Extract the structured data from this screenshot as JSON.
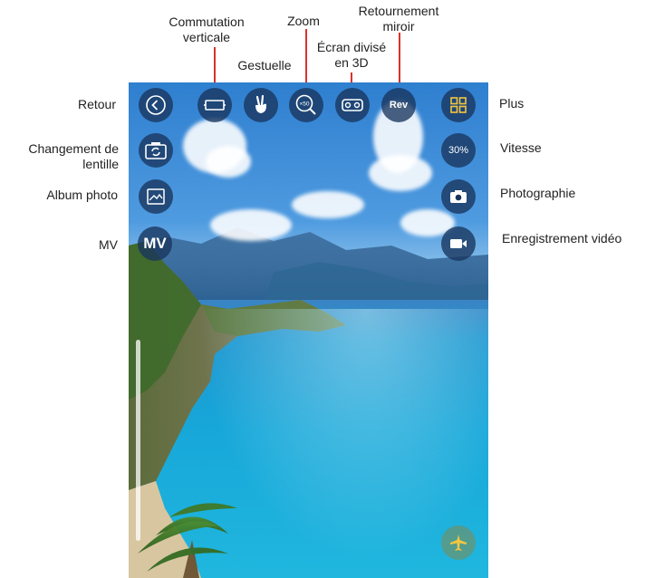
{
  "annotations": {
    "retour": "Retour",
    "changement": "Changement de\nlentille",
    "album": "Album photo",
    "mv": "MV",
    "commutation": "Commutation\nverticale",
    "gestuelle": "Gestuelle",
    "zoom": "Zoom",
    "ecran": "Écran divisé\nen 3D",
    "retournement": "Retournement\nmiroir",
    "plus": "Plus",
    "vitesse": "Vitesse",
    "photographie": "Photographie",
    "enregistrement": "Enregistrement vidéo"
  },
  "buttons": {
    "zoom_label": "×50",
    "rev_label": "Rev",
    "mv_label": "MV",
    "speed_label": "30%"
  },
  "icons": {
    "back": "chevron-left-icon",
    "vertical": "vertical-switch-icon",
    "gesture": "hand-gesture-icon",
    "zoom": "zoom-icon",
    "split": "vr-goggles-icon",
    "rev": "mirror-flip-icon",
    "more": "grid-icon",
    "lens": "camera-switch-icon",
    "album": "gallery-icon",
    "photo": "camera-icon",
    "video": "video-camera-icon",
    "plane": "airplane-icon"
  },
  "colors": {
    "button_bg": "#18345c",
    "accent_yellow": "#f2c641",
    "pointer_red": "#d9332b"
  }
}
